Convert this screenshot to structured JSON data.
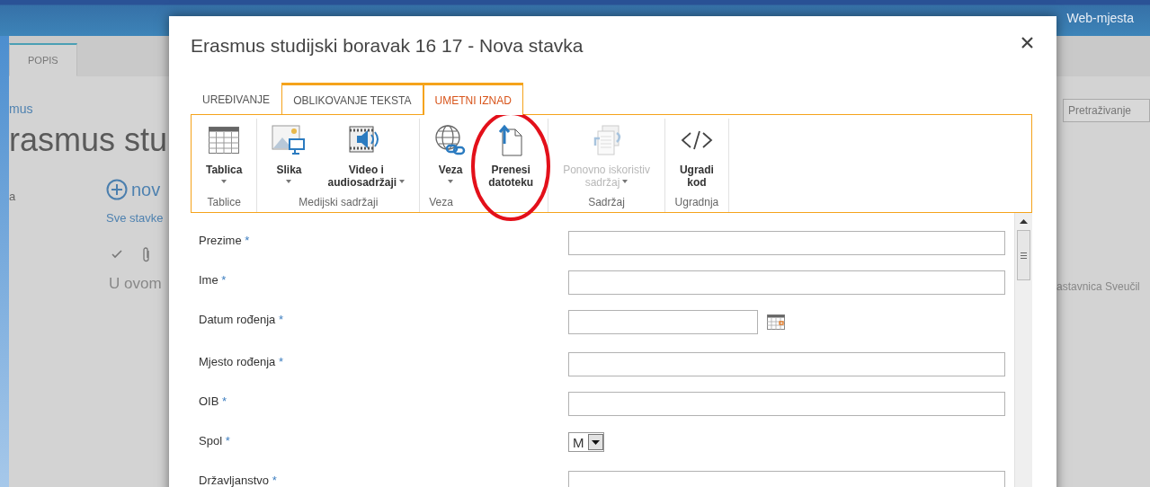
{
  "background": {
    "top_link": "Web-mjesta",
    "tabs": [
      {
        "label": "POPIS",
        "selected": true
      }
    ],
    "breadcrumb": "mus",
    "page_title": "rasmus stu",
    "nav_item": "a",
    "new_item": "nov",
    "view_link": "Sve stavke",
    "empty_text": "U ovom",
    "search": {
      "placeholder": "Pretraživanje"
    },
    "side_text": "astavnica Sveučil"
  },
  "dialog": {
    "title": "Erasmus studijski boravak 16 17 - Nova stavka",
    "ribbon_tabs": [
      {
        "label": "UREĐIVANJE",
        "selected": false,
        "contextual": false
      },
      {
        "label": "OBLIKOVANJE TEKSTA",
        "selected": false,
        "contextual": true
      },
      {
        "label": "UMETNI IZNAD",
        "selected": true,
        "contextual": true
      }
    ],
    "ribbon_groups": [
      {
        "label": "Tablice",
        "buttons": [
          {
            "kind": "table",
            "lines": [
              "Tablica"
            ],
            "dropdown": true,
            "disabled": false
          }
        ]
      },
      {
        "label": "Medijski sadržaji",
        "buttons": [
          {
            "kind": "picture",
            "lines": [
              "Slika"
            ],
            "dropdown": true,
            "disabled": false
          },
          {
            "kind": "video",
            "lines": [
              "Video i",
              "audiosadržaji"
            ],
            "dropdown": true,
            "disabled": false
          }
        ]
      },
      {
        "label": "Veza",
        "buttons": [
          {
            "kind": "link",
            "lines": [
              "Veza"
            ],
            "dropdown": true,
            "disabled": false
          },
          {
            "kind": "upload",
            "lines": [
              "Prenesi",
              "datoteku"
            ],
            "dropdown": false,
            "disabled": false
          }
        ]
      },
      {
        "label": "Sadržaj",
        "buttons": [
          {
            "kind": "reuse",
            "lines": [
              "Ponovno iskoristiv",
              "sadržaj"
            ],
            "dropdown": true,
            "disabled": true
          }
        ]
      },
      {
        "label": "Ugradnja",
        "buttons": [
          {
            "kind": "embed",
            "lines": [
              "Ugradi",
              "kod"
            ],
            "dropdown": false,
            "disabled": false
          }
        ]
      }
    ],
    "fields": [
      {
        "label": "Prezime",
        "required_mark": "*",
        "kind": "text"
      },
      {
        "label": "Ime",
        "required_mark": "*",
        "kind": "text"
      },
      {
        "label": "Datum rođenja",
        "required_mark": "*",
        "kind": "date"
      },
      {
        "label": "Mjesto rođenja",
        "required_mark": "*",
        "kind": "text"
      },
      {
        "label": "OIB",
        "required_mark": "*",
        "kind": "text"
      },
      {
        "label": "Spol",
        "required_mark": "*",
        "kind": "select",
        "value": "M"
      },
      {
        "label": "Državljanstvo",
        "required_mark": "*",
        "kind": "text"
      }
    ]
  }
}
